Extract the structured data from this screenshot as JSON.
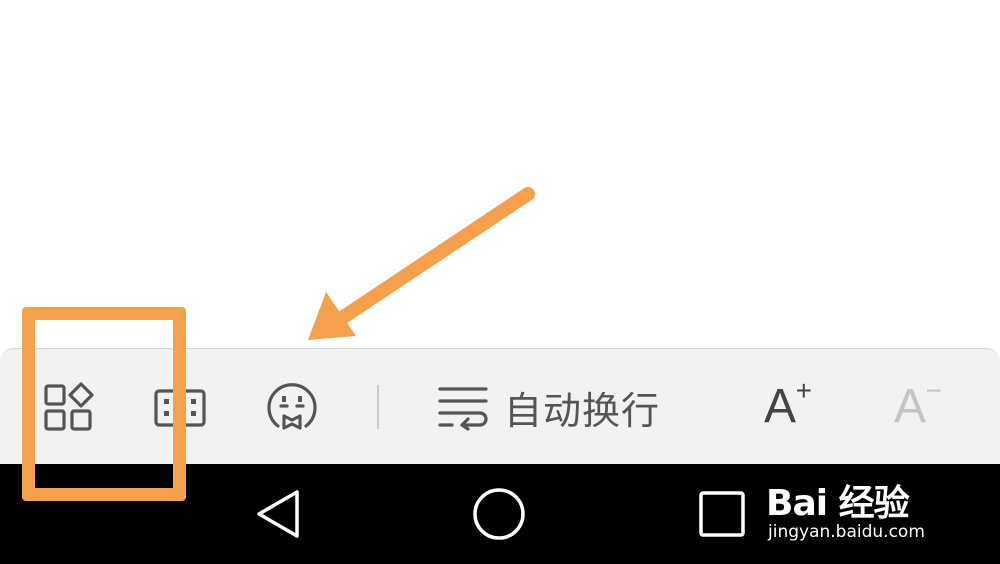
{
  "toolbar": {
    "buttons": [
      {
        "name": "apps",
        "icon": "apps-grid-icon"
      },
      {
        "name": "keyboard",
        "icon": "keyboard-icon"
      },
      {
        "name": "emoji",
        "icon": "emoji-face-icon"
      }
    ],
    "wrap_label": "自动换行",
    "wrap_icon": "text-wrap-icon",
    "font_increase": {
      "glyph": "A",
      "sup": "+",
      "icon": "font-increase-icon"
    },
    "font_decrease": {
      "glyph": "A",
      "sup": "−",
      "icon": "font-decrease-icon",
      "state": "disabled"
    }
  },
  "navbar": {
    "back_icon": "back-triangle-icon",
    "home_icon": "home-circle-icon",
    "recent_icon": "recent-apps-square-icon"
  },
  "watermark": {
    "logo_text": "Bai 经验",
    "url": "jingyan.baidu.com"
  },
  "annotations": {
    "color": "#f5a04d"
  },
  "colors": {
    "toolbar_bg": "#f2f2f2",
    "icon": "#555555",
    "disabled": "#c4c4c4",
    "navbar_bg": "#000000"
  }
}
